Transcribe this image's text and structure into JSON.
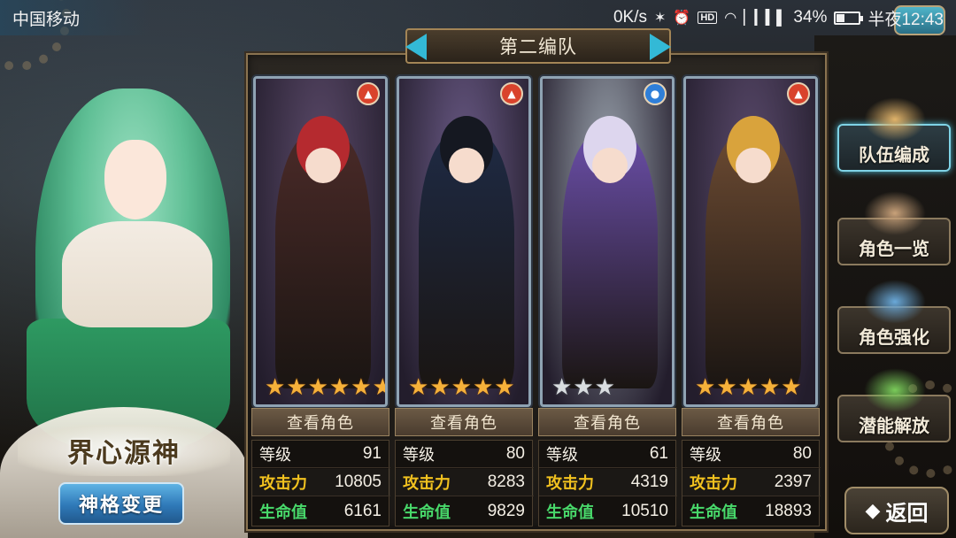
{
  "status_bar": {
    "carrier": "中国移动",
    "net_speed": "0K/s",
    "battery_percent": "34%",
    "battery_level": 0.34,
    "time": "半夜12:43"
  },
  "team": {
    "name": "第二编队"
  },
  "deity": {
    "name": "界心源神",
    "change_button": "神格变更"
  },
  "cards": [
    {
      "element": "fire",
      "stars_total": 6,
      "stars_filled": 6,
      "star_color": "gold",
      "view_label": "查看角色",
      "level_label": "等级",
      "level": "91",
      "atk_label": "攻击力",
      "atk": "10805",
      "hp_label": "生命值",
      "hp": "6161",
      "palette": {
        "bg": "#5b4a6a",
        "hair": "#b52a2f",
        "outfit": "#4a2a28"
      }
    },
    {
      "element": "fire",
      "stars_total": 5,
      "stars_filled": 5,
      "star_color": "gold",
      "view_label": "查看角色",
      "level_label": "等级",
      "level": "80",
      "atk_label": "攻击力",
      "atk": "8283",
      "hp_label": "生命值",
      "hp": "9829",
      "palette": {
        "bg": "#6a5a86",
        "hair": "#151821",
        "outfit": "#1e2a44"
      }
    },
    {
      "element": "water",
      "stars_total": 3,
      "stars_filled": 3,
      "star_color": "silver",
      "view_label": "查看角色",
      "level_label": "等级",
      "level": "61",
      "atk_label": "攻击力",
      "atk": "4319",
      "hp_label": "生命值",
      "hp": "10510",
      "palette": {
        "bg": "#9aa3ad",
        "hair": "#ddd6ee",
        "outfit": "#6a4ea8"
      }
    },
    {
      "element": "fire",
      "stars_total": 5,
      "stars_filled": 5,
      "star_color": "gold",
      "view_label": "查看角色",
      "level_label": "等级",
      "level": "80",
      "atk_label": "攻击力",
      "atk": "2397",
      "hp_label": "生命值",
      "hp": "18893",
      "palette": {
        "bg": "#5a4a6c",
        "hair": "#d9a33c",
        "outfit": "#6b4a32"
      }
    }
  ],
  "menu": [
    {
      "label": "队伍编成",
      "icon": "party-portraits-icon",
      "active": true
    },
    {
      "label": "角色一览",
      "icon": "book-icon",
      "active": false
    },
    {
      "label": "角色强化",
      "icon": "crystal-upgrade-icon",
      "active": false
    },
    {
      "label": "潜能解放",
      "icon": "green-orb-icon",
      "active": false
    }
  ],
  "back_button": {
    "label": "返回"
  },
  "colors": {
    "accent_cyan": "#33b9d6",
    "attack": "#f2c21f",
    "hp": "#48d86a",
    "fire": "#d9432c",
    "water": "#2f7fd9"
  }
}
